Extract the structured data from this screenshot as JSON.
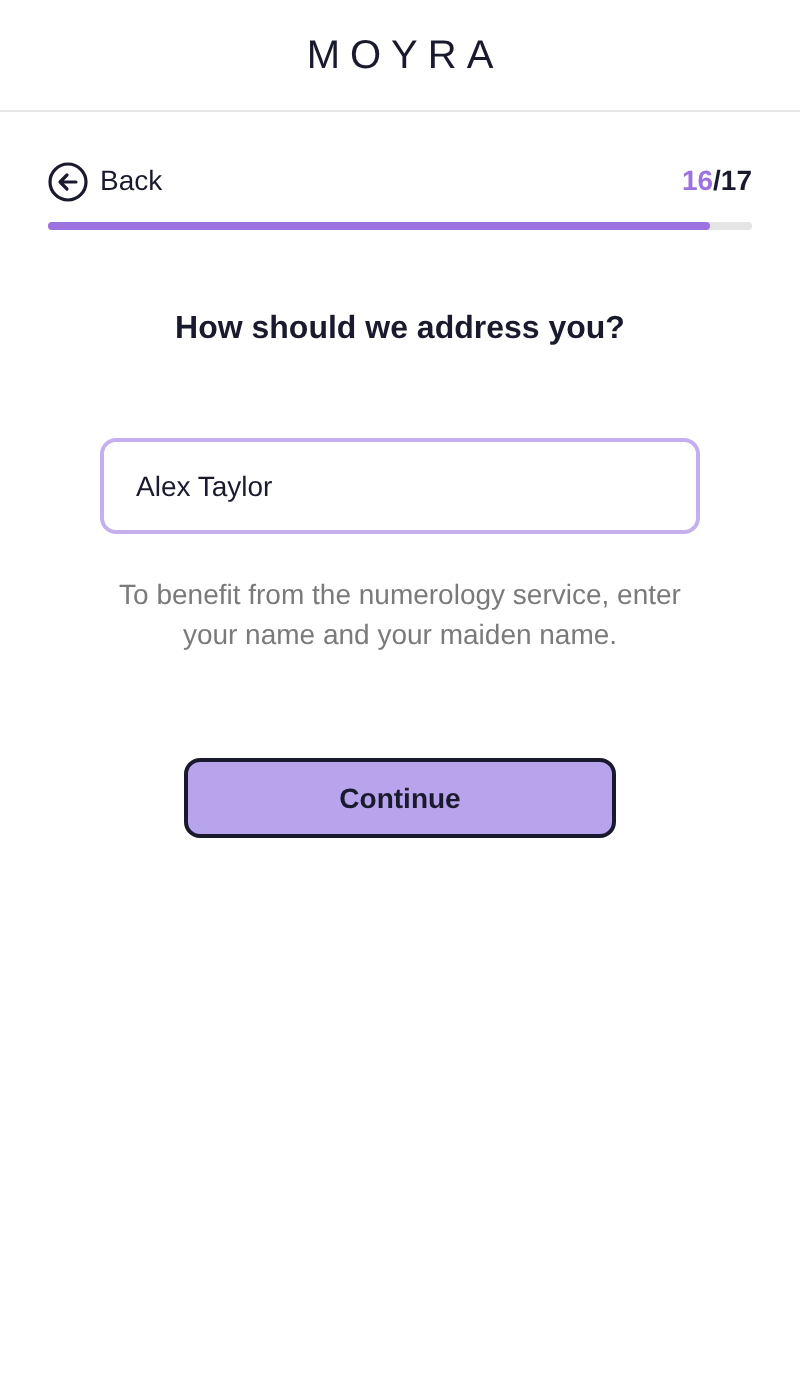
{
  "header": {
    "logo": "MOYRA"
  },
  "nav": {
    "back": "Back",
    "step_current": "16",
    "step_total": "/17"
  },
  "progress": {
    "level": 0.94
  },
  "question": "How should we address you?",
  "name_field": {
    "value": "Alex Taylor"
  },
  "hint": "To benefit from the numerology service, enter your name and your maiden name.",
  "continue_button": "Continue"
}
